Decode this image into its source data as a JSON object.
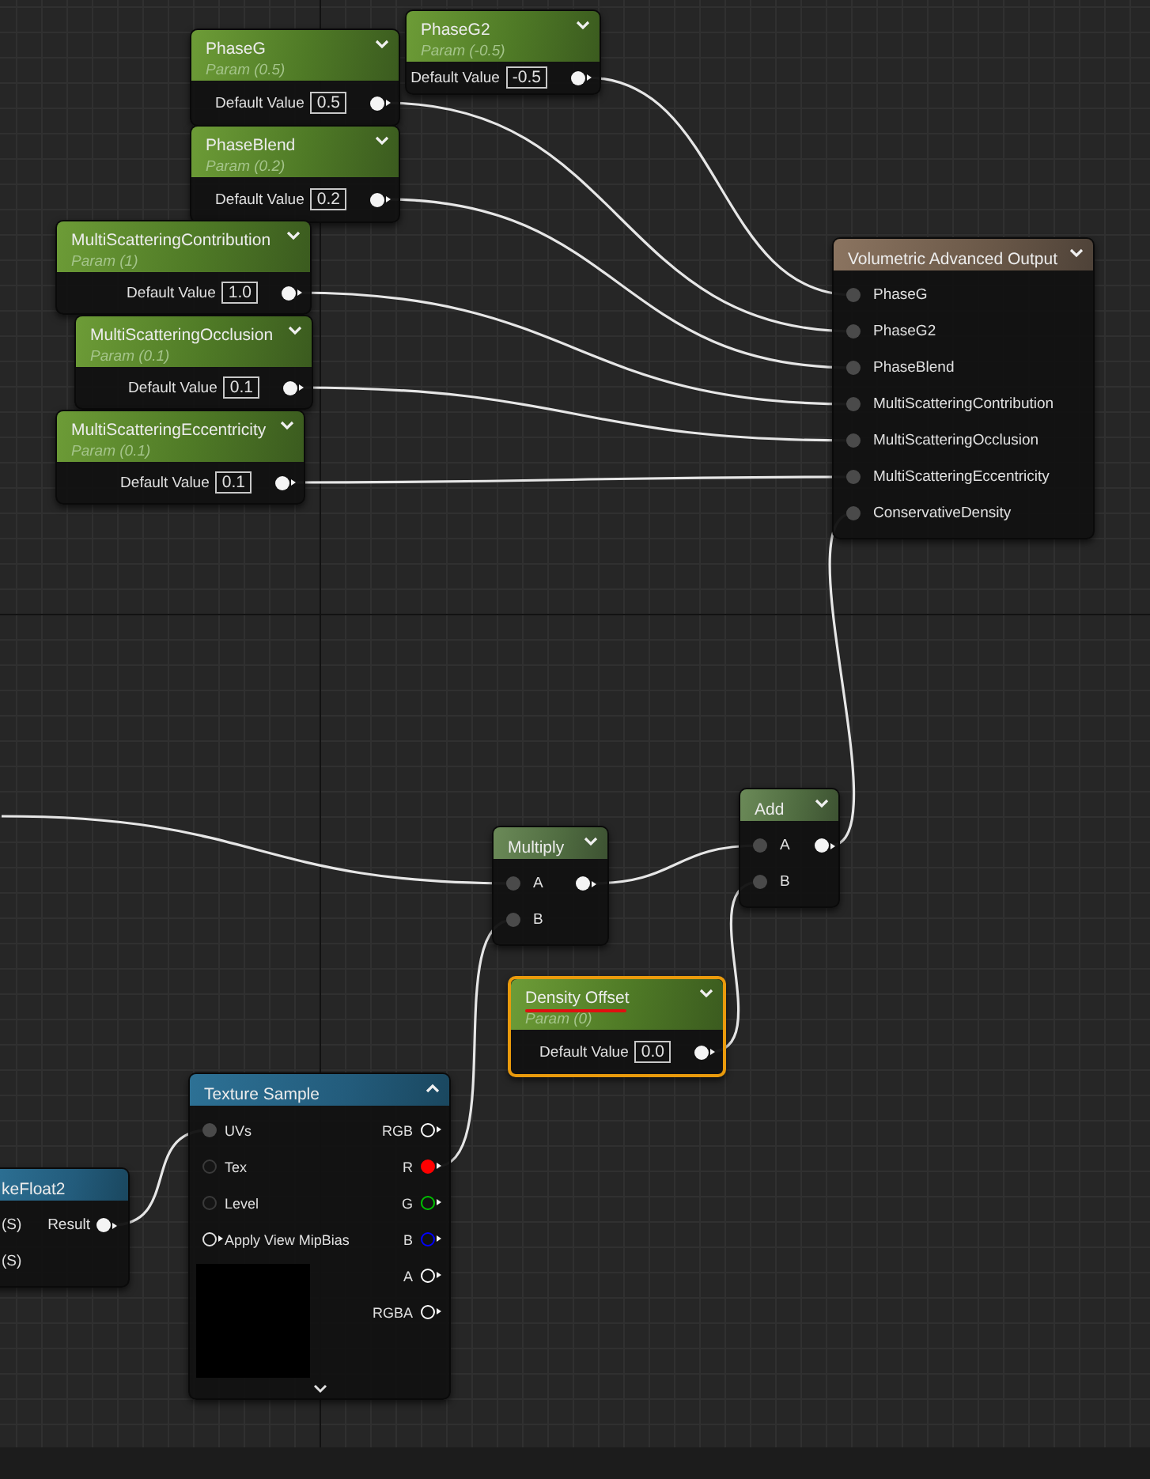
{
  "parameter_nodes": [
    {
      "title": "PhaseG",
      "subtitle": "Param (0.5)",
      "label": "Default Value",
      "value": "0.5",
      "selected": false,
      "underlined": false
    },
    {
      "title": "PhaseG2",
      "subtitle": "Param (-0.5)",
      "label": "Default Value",
      "value": "-0.5",
      "selected": false,
      "underlined": false
    },
    {
      "title": "PhaseBlend",
      "subtitle": "Param (0.2)",
      "label": "Default Value",
      "value": "0.2",
      "selected": false,
      "underlined": false
    },
    {
      "title": "MultiScatteringContribution",
      "subtitle": "Param (1)",
      "label": "Default Value",
      "value": "1.0",
      "selected": false,
      "underlined": false
    },
    {
      "title": "MultiScatteringOcclusion",
      "subtitle": "Param (0.1)",
      "label": "Default Value",
      "value": "0.1",
      "selected": false,
      "underlined": false
    },
    {
      "title": "MultiScatteringEccentricity",
      "subtitle": "Param (0.1)",
      "label": "Default Value",
      "value": "0.1",
      "selected": false,
      "underlined": false
    },
    {
      "title": "Density Offset",
      "subtitle": "Param (0)",
      "label": "Default Value",
      "value": "0.0",
      "selected": true,
      "underlined": true
    }
  ],
  "output_node": {
    "title": "Volumetric Advanced Output",
    "inputs": [
      {
        "label": "PhaseG",
        "connected": true
      },
      {
        "label": "PhaseG2",
        "connected": true
      },
      {
        "label": "PhaseBlend",
        "connected": true
      },
      {
        "label": "MultiScatteringContribution",
        "connected": true
      },
      {
        "label": "MultiScatteringOcclusion",
        "connected": true
      },
      {
        "label": "MultiScatteringEccentricity",
        "connected": true
      },
      {
        "label": "ConservativeDensity",
        "connected": true
      }
    ]
  },
  "math_nodes": [
    {
      "title": "Add",
      "inputs": [
        {
          "label": "A",
          "connected": true
        },
        {
          "label": "B",
          "connected": true
        }
      ]
    },
    {
      "title": "Multiply",
      "inputs": [
        {
          "label": "A",
          "connected": true
        },
        {
          "label": "B",
          "connected": true
        }
      ]
    }
  ],
  "make_float_node": {
    "title": "keFloat2",
    "inputs": [
      {
        "label": "(S)"
      },
      {
        "label": "(S)"
      }
    ],
    "output": "Result"
  },
  "texture_sample_node": {
    "title": "Texture Sample",
    "inputs": [
      {
        "label": "UVs",
        "kind": "scalar",
        "connected": true
      },
      {
        "label": "Tex",
        "kind": "scalar",
        "connected": false
      },
      {
        "label": "Level",
        "kind": "scalar",
        "connected": false
      },
      {
        "label": "Apply View MipBias",
        "kind": "toggle",
        "connected": false
      }
    ],
    "outputs": [
      {
        "label": "RGB",
        "color": "#ffffff",
        "connected": false
      },
      {
        "label": "R",
        "color": "#ff0000",
        "connected": true
      },
      {
        "label": "G",
        "color": "#00c000",
        "connected": false
      },
      {
        "label": "B",
        "color": "#0000ff",
        "connected": false
      },
      {
        "label": "A",
        "color": "#ffffff",
        "connected": false
      },
      {
        "label": "RGBA",
        "color": "#ffffff",
        "connected": false
      }
    ]
  }
}
